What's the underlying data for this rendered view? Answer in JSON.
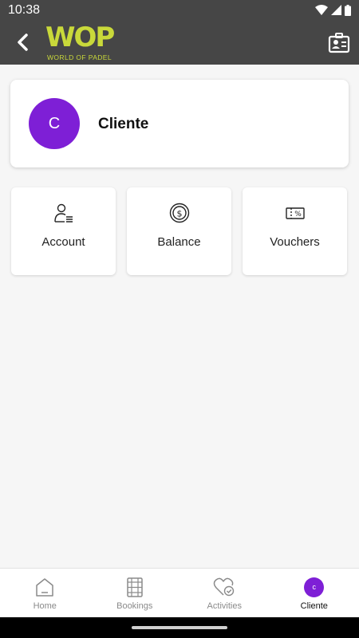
{
  "status_bar": {
    "time": "10:38"
  },
  "app_bar": {
    "logo_text": "WOP",
    "logo_subtitle": "WORLD OF PADEL",
    "brand_color": "#c9d93a",
    "back_icon": "chevron-left-icon",
    "contact_icon": "contact-card-icon"
  },
  "profile": {
    "initial": "C",
    "name": "Cliente",
    "avatar_color": "#7e1fd6"
  },
  "tiles": [
    {
      "label": "Account",
      "icon": "account-list-icon"
    },
    {
      "label": "Balance",
      "icon": "dollar-coin-icon"
    },
    {
      "label": "Vouchers",
      "icon": "voucher-percent-icon"
    }
  ],
  "bottom_nav": {
    "items": [
      {
        "label": "Home",
        "icon": "home-icon"
      },
      {
        "label": "Bookings",
        "icon": "court-icon"
      },
      {
        "label": "Activities",
        "icon": "heart-check-icon"
      },
      {
        "label": "Cliente",
        "icon": "avatar",
        "initial": "c",
        "active": true
      }
    ]
  }
}
